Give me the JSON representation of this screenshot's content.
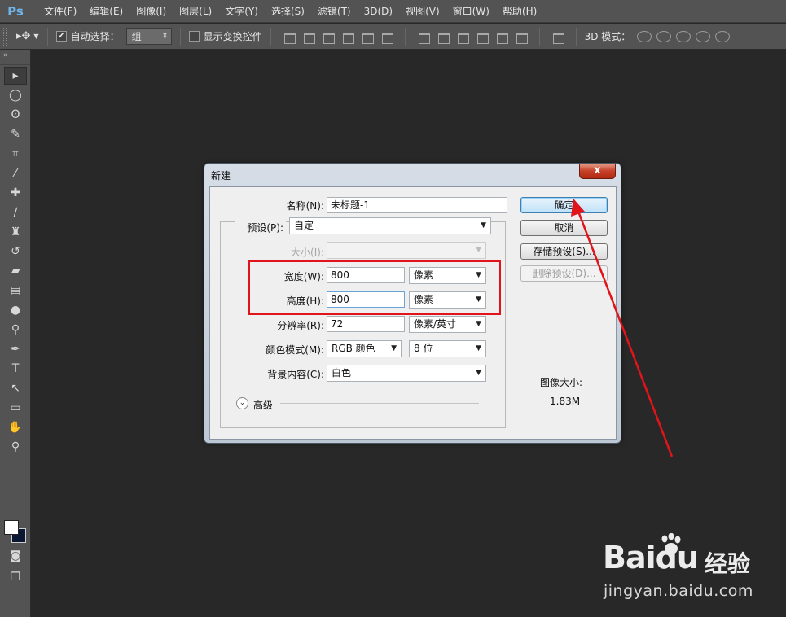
{
  "app": {
    "logo": "Ps"
  },
  "menu": [
    "文件(F)",
    "编辑(E)",
    "图像(I)",
    "图层(L)",
    "文字(Y)",
    "选择(S)",
    "滤镜(T)",
    "3D(D)",
    "视图(V)",
    "窗口(W)",
    "帮助(H)"
  ],
  "options": {
    "auto_select_label": "自动选择：",
    "auto_select_value": "组",
    "show_transform_label": "显示变换控件",
    "mode3d_label": "3D 模式："
  },
  "dialog": {
    "title": "新建",
    "close": "x",
    "name_label": "名称(N):",
    "name_value": "未标题-1",
    "preset_label": "预设(P):",
    "preset_value": "自定",
    "size_label": "大小(I):",
    "size_value": "",
    "width_label": "宽度(W):",
    "width_value": "800",
    "width_unit": "像素",
    "height_label": "高度(H):",
    "height_value": "800",
    "height_unit": "像素",
    "resolution_label": "分辨率(R):",
    "resolution_value": "72",
    "resolution_unit": "像素/英寸",
    "color_mode_label": "颜色模式(M):",
    "color_mode_value": "RGB 颜色",
    "bit_depth_value": "8 位",
    "bg_label": "背景内容(C):",
    "bg_value": "白色",
    "advanced_label": "高级",
    "image_size_label": "图像大小:",
    "image_size_value": "1.83M",
    "buttons": {
      "ok": "确定",
      "cancel": "取消",
      "save_preset": "存储预设(S)...",
      "delete_preset": "删除预设(D)..."
    }
  },
  "watermark": {
    "logo": "Bai",
    "logo_end": "du",
    "cn": "经验",
    "url": "jingyan.baidu.com"
  },
  "colors": {
    "accent_red": "#e0141a",
    "foreground": "#ffffff",
    "background": "#0b1633"
  }
}
